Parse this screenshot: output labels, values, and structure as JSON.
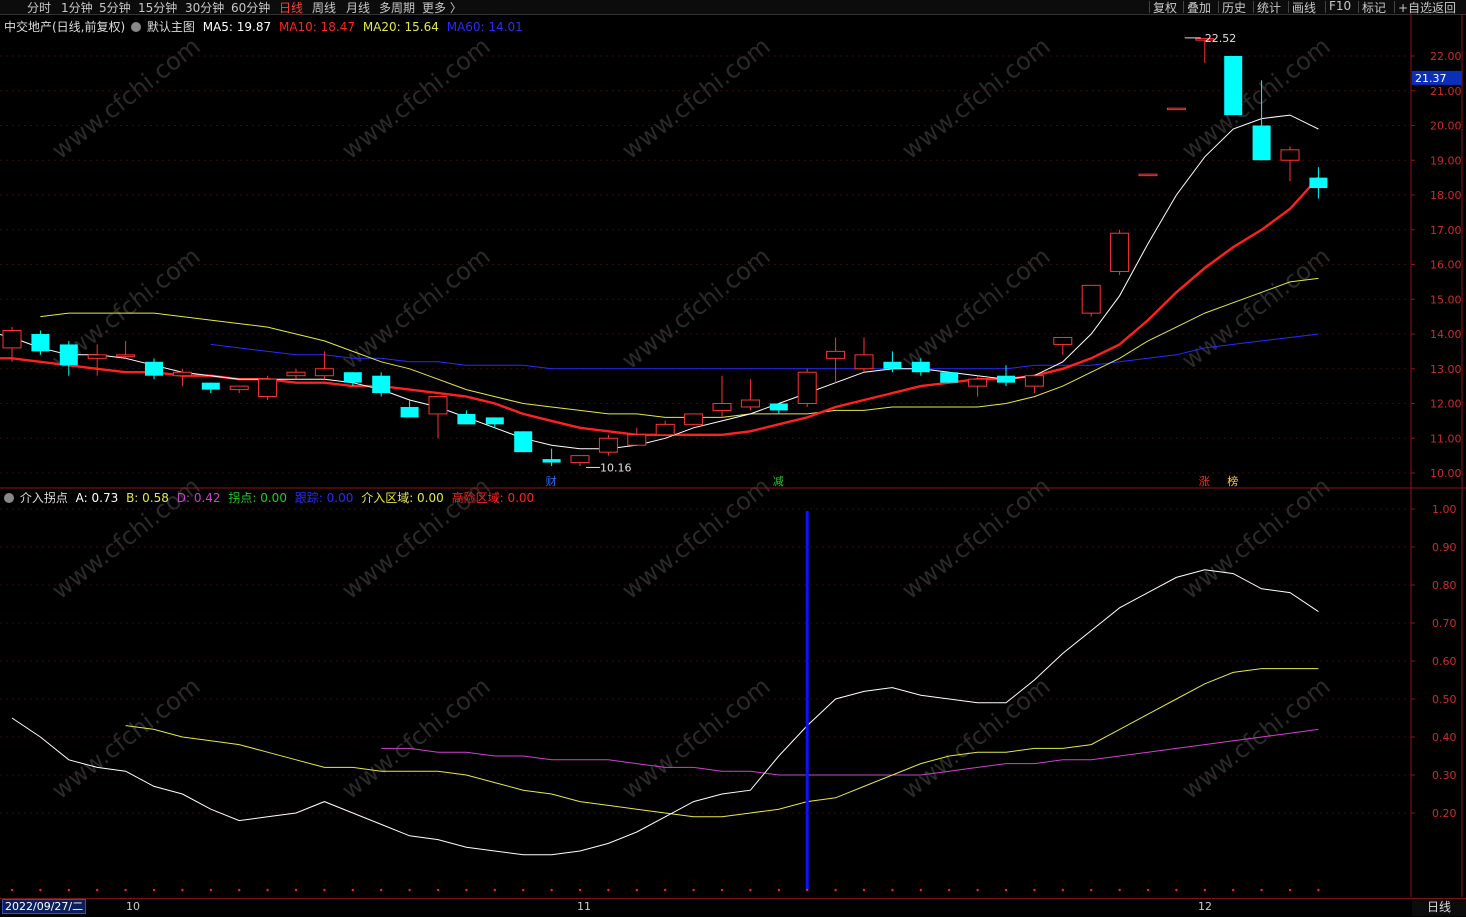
{
  "toolbar": {
    "left_items": [
      "分时",
      "1分钟",
      "5分钟",
      "15分钟",
      "30分钟",
      "60分钟",
      "日线",
      "周线",
      "月线",
      "多周期",
      "更多 〉"
    ],
    "active": "日线",
    "right_items": [
      "复权",
      "叠加",
      "历史",
      "统计",
      "画线",
      "F10",
      "标记",
      "+自选",
      "返回"
    ]
  },
  "main": {
    "title": "中交地产(日线,前复权)",
    "template": "默认主图",
    "ma5": "MA5: 19.87",
    "ma10": "MA10: 18.47",
    "ma20": "MA20: 15.64",
    "ma60": "MA60: 14.01",
    "price_tag": "21.37",
    "high_label": "22.52",
    "low_label": "10.16",
    "y_ticks": [
      "22.00",
      "21.00",
      "20.00",
      "19.00",
      "18.00",
      "17.00",
      "16.00",
      "15.00",
      "14.00",
      "13.00",
      "12.00",
      "11.00",
      "10.00"
    ],
    "markers": [
      "财",
      "减",
      "涨",
      "榜"
    ]
  },
  "indicator": {
    "name": "介入拐点",
    "a": "A: 0.73",
    "b": "B: 0.58",
    "d": "D: 0.42",
    "guai": "拐点: 0.00",
    "gen": "跟踪: 0.00",
    "jieru": "介入区域: 0.00",
    "risk": "高险区域: 0.00",
    "y_ticks": [
      "1.00",
      "0.90",
      "0.80",
      "0.70",
      "0.60",
      "0.50",
      "0.40",
      "0.30",
      "0.20"
    ]
  },
  "status": {
    "date": "2022/09/27/二",
    "month_labels": [
      "10",
      "11",
      "12"
    ],
    "period": "日线"
  },
  "watermark": "www.cfchi.com",
  "colors": {
    "up": "#ff3232",
    "down": "#00ffff",
    "ma5": "#ffffff",
    "ma10": "#ff2020",
    "ma20": "#e6e64a",
    "ma60": "#2a2aff",
    "ind_a": "#ffffff",
    "ind_b": "#e6e64a",
    "ind_d": "#d040d0",
    "signal": "#1010ff"
  },
  "chart_data": [
    {
      "type": "candlestick",
      "title": "中交地产(日线,前复权)",
      "ylim": [
        10.0,
        22.0
      ],
      "candles": [
        [
          13.6,
          14.2,
          13.2,
          14.1
        ],
        [
          14.0,
          14.1,
          13.4,
          13.5
        ],
        [
          13.7,
          13.8,
          12.8,
          13.1
        ],
        [
          13.3,
          13.7,
          12.8,
          13.4
        ],
        [
          13.4,
          13.8,
          13.3,
          13.4
        ],
        [
          13.2,
          13.3,
          12.7,
          12.8
        ],
        [
          12.8,
          13.0,
          12.5,
          12.9
        ],
        [
          12.6,
          12.6,
          12.3,
          12.4
        ],
        [
          12.4,
          12.5,
          12.3,
          12.5
        ],
        [
          12.2,
          12.8,
          12.1,
          12.7
        ],
        [
          12.8,
          13.0,
          12.7,
          12.9
        ],
        [
          12.8,
          13.5,
          12.7,
          13.0
        ],
        [
          12.9,
          12.9,
          12.5,
          12.6
        ],
        [
          12.8,
          12.9,
          12.2,
          12.3
        ],
        [
          11.9,
          12.1,
          11.6,
          11.6
        ],
        [
          11.7,
          11.8,
          11.0,
          12.2
        ],
        [
          11.7,
          11.8,
          11.4,
          11.4
        ],
        [
          11.6,
          11.6,
          11.3,
          11.4
        ],
        [
          11.2,
          11.2,
          10.6,
          10.6
        ],
        [
          10.4,
          10.7,
          10.2,
          10.3
        ],
        [
          10.3,
          10.5,
          10.2,
          10.5
        ],
        [
          10.6,
          11.1,
          10.5,
          11.0
        ],
        [
          10.8,
          11.3,
          10.8,
          11.1
        ],
        [
          11.1,
          11.5,
          11.1,
          11.4
        ],
        [
          11.4,
          11.7,
          11.4,
          11.7
        ],
        [
          11.8,
          12.8,
          11.6,
          12.0
        ],
        [
          11.9,
          12.7,
          11.8,
          12.1
        ],
        [
          12.0,
          12.0,
          11.7,
          11.8
        ],
        [
          12.0,
          13.0,
          11.9,
          12.9
        ],
        [
          13.3,
          13.9,
          12.6,
          13.5
        ],
        [
          13.0,
          13.9,
          12.9,
          13.4
        ],
        [
          13.2,
          13.5,
          12.9,
          13.0
        ],
        [
          13.2,
          13.3,
          12.8,
          12.9
        ],
        [
          12.9,
          12.9,
          12.6,
          12.6
        ],
        [
          12.5,
          12.8,
          12.2,
          12.7
        ],
        [
          12.8,
          13.1,
          12.5,
          12.6
        ],
        [
          12.5,
          12.8,
          12.3,
          12.8
        ],
        [
          13.7,
          13.9,
          13.4,
          13.9
        ],
        [
          14.6,
          15.4,
          14.5,
          15.4
        ],
        [
          15.8,
          17.0,
          15.7,
          16.9
        ],
        [
          18.6,
          18.6,
          18.6,
          18.6
        ],
        [
          20.5,
          20.5,
          20.5,
          20.5
        ],
        [
          22.5,
          22.5,
          21.8,
          22.5
        ],
        [
          22.0,
          22.0,
          20.3,
          20.3
        ],
        [
          20.0,
          21.3,
          19.0,
          19.0
        ],
        [
          19.0,
          19.4,
          18.4,
          19.3
        ],
        [
          18.5,
          18.8,
          17.9,
          18.2
        ]
      ],
      "series": [
        {
          "name": "MA5",
          "values": [
            14.1,
            13.9,
            13.6,
            13.4,
            13.4,
            13.3,
            13.1,
            12.9,
            12.8,
            12.7,
            12.7,
            12.7,
            12.7,
            12.6,
            12.4,
            12.1,
            11.9,
            11.6,
            11.3,
            11.0,
            10.8,
            10.7,
            10.7,
            10.8,
            11.0,
            11.3,
            11.5,
            11.7,
            12.0,
            12.3,
            12.6,
            12.9,
            13.0,
            13.0,
            12.9,
            12.8,
            12.7,
            12.8,
            13.2,
            14.0,
            15.1,
            16.6,
            18.0,
            19.1,
            19.9,
            20.2,
            20.3,
            19.9
          ]
        },
        {
          "name": "MA10",
          "values": [
            13.3,
            13.3,
            13.2,
            13.1,
            13.0,
            12.9,
            12.9,
            12.8,
            12.8,
            12.7,
            12.7,
            12.6,
            12.6,
            12.5,
            12.5,
            12.4,
            12.3,
            12.2,
            12.0,
            11.7,
            11.5,
            11.3,
            11.2,
            11.1,
            11.1,
            11.1,
            11.1,
            11.2,
            11.4,
            11.6,
            11.9,
            12.1,
            12.3,
            12.5,
            12.6,
            12.7,
            12.7,
            12.8,
            13.0,
            13.3,
            13.7,
            14.4,
            15.2,
            15.9,
            16.5,
            17.0,
            17.6,
            18.5
          ]
        },
        {
          "name": "MA20",
          "values": [
            14.5,
            14.6,
            14.6,
            14.6,
            14.6,
            14.5,
            14.4,
            14.3,
            14.2,
            14.0,
            13.8,
            13.5,
            13.2,
            13.0,
            12.7,
            12.4,
            12.2,
            12.0,
            11.9,
            11.8,
            11.7,
            11.7,
            11.6,
            11.6,
            11.6,
            11.7,
            11.7,
            11.7,
            11.8,
            11.8,
            11.9,
            11.9,
            11.9,
            11.9,
            12.0,
            12.2,
            12.5,
            12.9,
            13.3,
            13.8,
            14.2,
            14.6,
            14.9,
            15.2,
            15.5,
            15.6
          ]
        },
        {
          "name": "MA60",
          "values": [
            13.7,
            13.6,
            13.5,
            13.4,
            13.4,
            13.3,
            13.3,
            13.2,
            13.2,
            13.1,
            13.1,
            13.1,
            13.0,
            13.0,
            13.0,
            13.0,
            13.0,
            13.0,
            13.0,
            13.0,
            13.0,
            13.0,
            13.0,
            13.0,
            13.0,
            13.0,
            13.0,
            13.0,
            13.0,
            13.1,
            13.1,
            13.1,
            13.2,
            13.3,
            13.4,
            13.6,
            13.7,
            13.8,
            13.9,
            14.0
          ]
        }
      ],
      "annotations": [
        {
          "text": "22.52"
        },
        {
          "text": "10.16"
        }
      ]
    },
    {
      "type": "line",
      "title": "介入拐点",
      "ylim": [
        0.1,
        1.05
      ],
      "series": [
        {
          "name": "A",
          "values": [
            0.45,
            0.4,
            0.34,
            0.32,
            0.31,
            0.27,
            0.25,
            0.21,
            0.18,
            0.19,
            0.2,
            0.23,
            0.2,
            0.17,
            0.14,
            0.13,
            0.11,
            0.1,
            0.09,
            0.09,
            0.1,
            0.12,
            0.15,
            0.19,
            0.23,
            0.25,
            0.26,
            0.35,
            0.43,
            0.5,
            0.52,
            0.53,
            0.51,
            0.5,
            0.49,
            0.49,
            0.55,
            0.62,
            0.68,
            0.74,
            0.78,
            0.82,
            0.84,
            0.83,
            0.79,
            0.78,
            0.73
          ]
        },
        {
          "name": "B",
          "values": [
            0.43,
            0.42,
            0.4,
            0.39,
            0.38,
            0.36,
            0.34,
            0.32,
            0.32,
            0.31,
            0.31,
            0.31,
            0.3,
            0.28,
            0.26,
            0.25,
            0.23,
            0.22,
            0.21,
            0.2,
            0.19,
            0.19,
            0.2,
            0.21,
            0.23,
            0.24,
            0.27,
            0.3,
            0.33,
            0.35,
            0.36,
            0.36,
            0.37,
            0.37,
            0.38,
            0.42,
            0.46,
            0.5,
            0.54,
            0.57,
            0.58,
            0.58,
            0.58
          ]
        },
        {
          "name": "D",
          "values": [
            0.37,
            0.37,
            0.36,
            0.36,
            0.35,
            0.35,
            0.34,
            0.34,
            0.34,
            0.33,
            0.32,
            0.32,
            0.31,
            0.31,
            0.3,
            0.3,
            0.3,
            0.3,
            0.3,
            0.3,
            0.31,
            0.32,
            0.33,
            0.33,
            0.34,
            0.34,
            0.35,
            0.36,
            0.37,
            0.38,
            0.39,
            0.4,
            0.41,
            0.42
          ]
        }
      ]
    }
  ]
}
